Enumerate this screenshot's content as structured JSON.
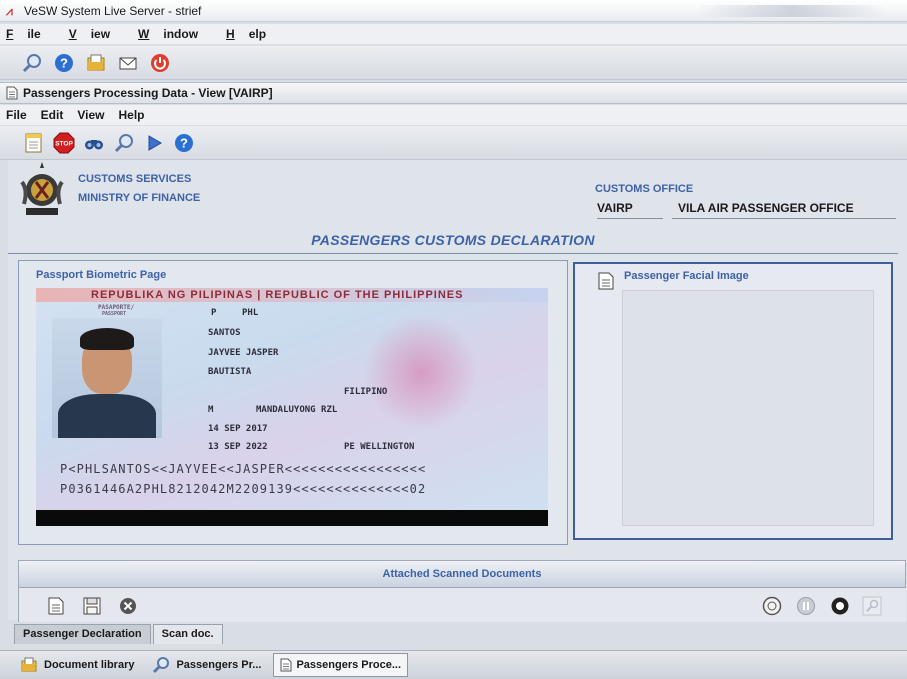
{
  "window": {
    "title": "VeSW System Live Server - strief"
  },
  "main_menu": [
    {
      "label": "File",
      "mnemonic": "F"
    },
    {
      "label": "View",
      "mnemonic": "V"
    },
    {
      "label": "Window",
      "mnemonic": "W"
    },
    {
      "label": "Help",
      "mnemonic": "H"
    }
  ],
  "main_toolbar": {
    "icons": [
      "search-icon",
      "help-icon",
      "document-library-icon",
      "mail-icon",
      "power-icon"
    ]
  },
  "inner_window": {
    "title": "Passengers Processing Data - View [VAIRP]",
    "menu": [
      "File",
      "Edit",
      "View",
      "Help"
    ],
    "toolbar_icons": [
      "new-document-icon",
      "stop-icon",
      "find-icon",
      "search-icon",
      "play-icon",
      "help-icon"
    ]
  },
  "header": {
    "org_line1": "CUSTOMS SERVICES",
    "org_line2": "MINISTRY OF FINANCE",
    "office_label": "CUSTOMS OFFICE",
    "office_code": "VAIRP",
    "office_name": "VILA AIR PASSENGER OFFICE"
  },
  "declaration_title": "PASSENGERS CUSTOMS DECLARATION",
  "passport_panel": {
    "label": "Passport Biometric Page",
    "document": {
      "header": "REPUBLIKA NG PILIPINAS | REPUBLIC OF THE PHILIPPINES",
      "doc_type": "PASAPORTE/",
      "doc_type_en": "PASSPORT",
      "type": "P",
      "country_code": "PHL",
      "surname": "SANTOS",
      "given_names": "JAYVEE JASPER",
      "middle_name": "BAUTISTA",
      "nationality": "FILIPINO",
      "sex": "M",
      "place_of_birth": "MANDALUYONG RZL",
      "date_of_issue": "14 SEP 2017",
      "date_of_expiry": "13 SEP 2022",
      "issuing_authority": "PE WELLINGTON",
      "mrz_line1": "P<PHLSANTOS<<JAYVEE<<JASPER<<<<<<<<<<<<<<<<<",
      "mrz_line2": "P0361446A2PHL8212042M2209139<<<<<<<<<<<<<<02"
    }
  },
  "facial_panel": {
    "label": "Passenger Facial Image"
  },
  "attached_docs": {
    "label": "Attached Scanned Documents"
  },
  "tabs": [
    {
      "label": "Passenger Declaration",
      "active": true
    },
    {
      "label": "Scan doc.",
      "active": false
    }
  ],
  "taskbar": [
    {
      "label": "Document library",
      "icon": "folder-icon",
      "active": false
    },
    {
      "label": "Passengers Pr...",
      "icon": "search-icon",
      "active": false
    },
    {
      "label": "Passengers Proce...",
      "icon": "document-icon",
      "active": true
    }
  ],
  "colors": {
    "accent": "#3d62a8",
    "stop": "#d22020",
    "panel_border": "#3d5e9b"
  }
}
